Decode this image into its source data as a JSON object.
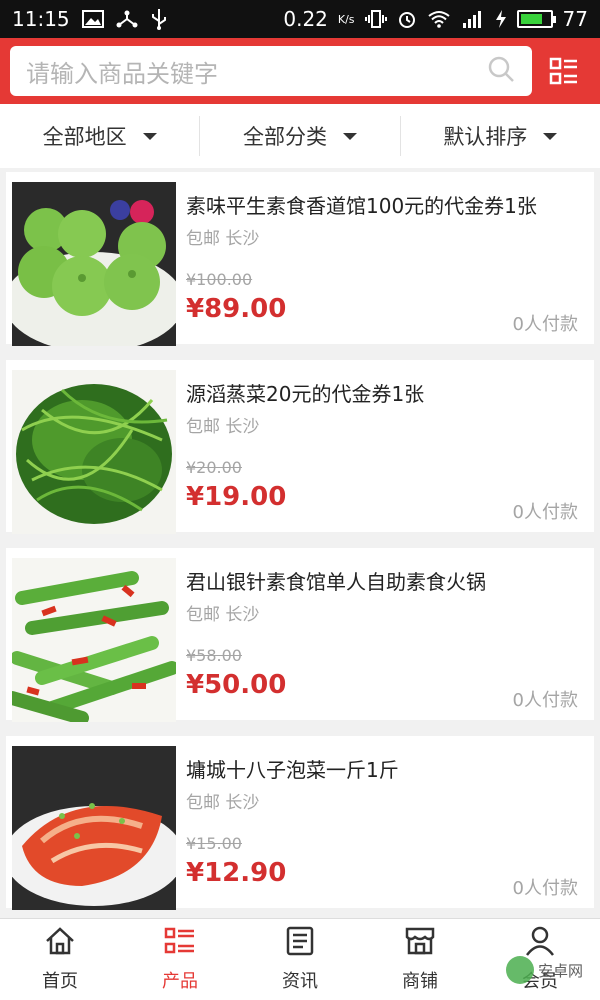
{
  "status_bar": {
    "time": "11:15",
    "speed": "0.22",
    "speed_unit": "K/s",
    "battery": "77",
    "battery_level": 0.77
  },
  "header": {
    "search_placeholder": "请输入商品关键字",
    "menu_icon": "list-grid-icon"
  },
  "filters": [
    {
      "label": "全部地区"
    },
    {
      "label": "全部分类"
    },
    {
      "label": "默认排序"
    }
  ],
  "products": [
    {
      "title": "素味平生素食香道馆100元的代金券1张",
      "meta": "包邮 长沙",
      "original_price": "¥100.00",
      "price": "¥89.00",
      "paid": "0人付款",
      "image": "steamed-buns"
    },
    {
      "title": "源滔蒸菜20元的代金券1张",
      "meta": "包邮 长沙",
      "original_price": "¥20.00",
      "price": "¥19.00",
      "paid": "0人付款",
      "image": "greens"
    },
    {
      "title": "君山银针素食馆单人自助素食火锅",
      "meta": "包邮 长沙",
      "original_price": "¥58.00",
      "price": "¥50.00",
      "paid": "0人付款",
      "image": "green-beans"
    },
    {
      "title": "墉城十八子泡菜一斤1斤",
      "meta": "包邮 长沙",
      "original_price": "¥15.00",
      "price": "¥12.90",
      "paid": "0人付款",
      "image": "kimchi"
    }
  ],
  "bottom_nav": [
    {
      "label": "首页",
      "icon": "home-icon"
    },
    {
      "label": "产品",
      "icon": "product-list-icon",
      "active": true
    },
    {
      "label": "资讯",
      "icon": "news-icon"
    },
    {
      "label": "商铺",
      "icon": "store-icon"
    },
    {
      "label": "会员",
      "icon": "member-icon"
    }
  ],
  "watermark": "安卓网",
  "colors": {
    "accent": "#e53935",
    "price": "#d32f2f",
    "status_bar": "#111111"
  }
}
